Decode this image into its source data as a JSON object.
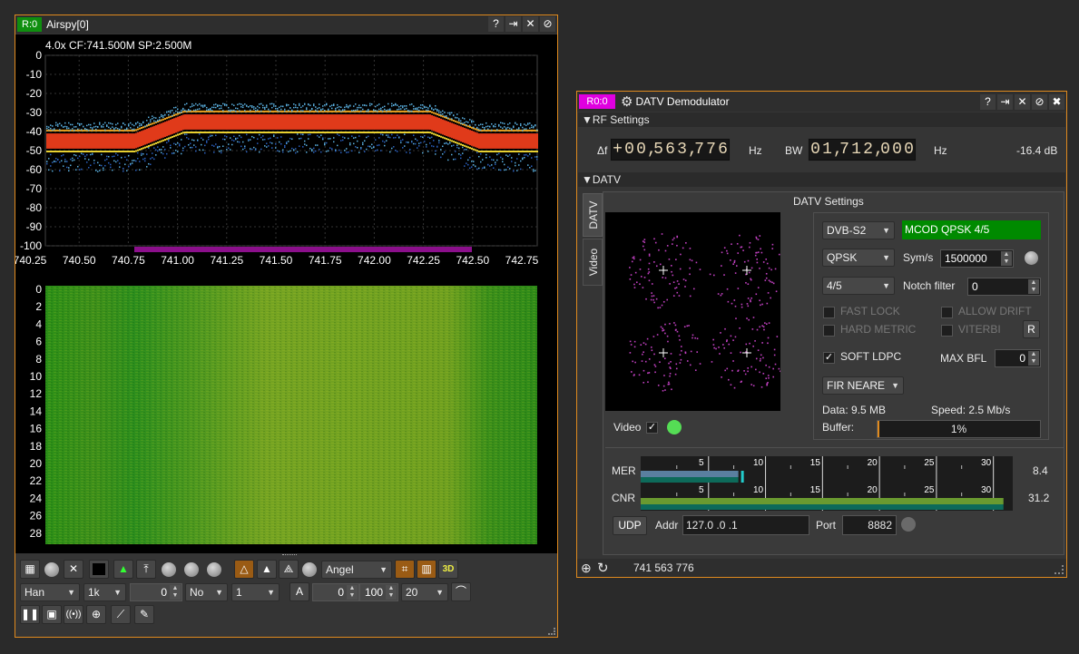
{
  "spectrum": {
    "rtag": "R:0",
    "title": "Airspy[0]",
    "info": "4.0x CF:741.500M SP:2.500M",
    "y_ticks": [
      "0",
      "-10",
      "-20",
      "-30",
      "-40",
      "-50",
      "-60",
      "-70",
      "-80",
      "-90",
      "-100"
    ],
    "x_ticks": [
      "740.25",
      "740.50",
      "740.75",
      "741.00",
      "741.25",
      "741.50",
      "741.75",
      "742.00",
      "742.25",
      "742.50",
      "742.75"
    ],
    "wf_ticks": [
      "0",
      "2",
      "4",
      "6",
      "8",
      "10",
      "12",
      "14",
      "16",
      "18",
      "20",
      "22",
      "24",
      "26",
      "28"
    ],
    "toolbar": {
      "palette": "Angel",
      "window": "Han",
      "fft_size": "1k",
      "overlap": "0",
      "averaging_mode": "No",
      "averaging": "1",
      "auto_btn": "A",
      "ref_level": "0",
      "range": "100",
      "fps": "20"
    }
  },
  "datv": {
    "rtag": "R0:0",
    "title": "DATV Demodulator",
    "rf_section": "RF Settings",
    "df_label": "Δf",
    "df_value": "+00,563,776",
    "df_unit": "Hz",
    "bw_label": "BW",
    "bw_value": "01,712,000",
    "bw_unit": "Hz",
    "power": "-16.4 dB",
    "datv_section": "DATV",
    "tabs": [
      "DATV",
      "Video"
    ],
    "settings_title": "DATV Settings",
    "standard": "DVB-S2",
    "modcod_status": "MCOD QPSK 4/5",
    "modulation": "QPSK",
    "sym_label": "Sym/s",
    "sym_value": "1500000",
    "fec": "4/5",
    "notch_label": "Notch filter",
    "notch_value": "0",
    "fast_lock": "FAST LOCK",
    "allow_drift": "ALLOW DRIFT",
    "hard_metric": "HARD METRIC",
    "viterbi": "VITERBI",
    "r_btn": "R",
    "soft_ldpc": "SOFT LDPC",
    "max_bfl_label": "MAX BFL",
    "max_bfl_value": "0",
    "filter": "FIR NEARE",
    "data_text": "Data: 9.5 MB",
    "speed_text": "Speed: 2.5 Mb/s",
    "buffer_label": "Buffer:",
    "buffer_text": "1%",
    "buffer_fraction": 0.01,
    "video_label": "Video",
    "mer_label": "MER",
    "mer_value": "8.4",
    "cnr_label": "CNR",
    "cnr_value": "31.2",
    "meter_ticks": [
      "5",
      "10",
      "15",
      "20",
      "25",
      "30"
    ],
    "udp_btn": "UDP",
    "addr_label": "Addr",
    "addr_value": "127.0 .0 .1",
    "port_label": "Port",
    "port_value": "8882",
    "status_freq": "741 563 776"
  }
}
